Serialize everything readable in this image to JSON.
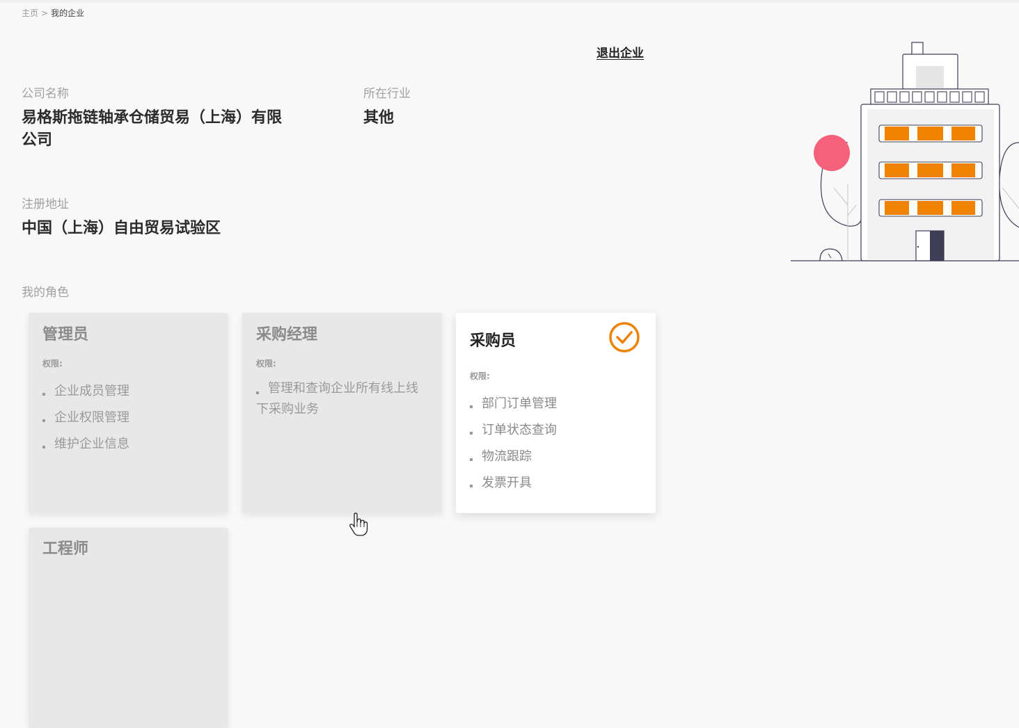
{
  "breadcrumb": {
    "home": "主页",
    "separator": ">",
    "current": "我的企业"
  },
  "actions": {
    "quit_label": "退出企业"
  },
  "company": {
    "name_label": "公司名称",
    "name_line1": "易格斯拖链轴承仓储贸易（上海）有限",
    "name_line2": "公司",
    "industry_label": "所在行业",
    "industry_value": "其他",
    "address_label": "注册地址",
    "address_value": "中国（上海）自由贸易试验区"
  },
  "roles": {
    "section_label": "我的角色",
    "items": [
      {
        "title": "管理员",
        "perm_label": "权限:",
        "perms": [
          "企业成员管理",
          "企业权限管理",
          "维护企业信息"
        ],
        "selected": false
      },
      {
        "title": "采购经理",
        "perm_label": "权限:",
        "perms": [
          "管理和查询企业所有线上线下采购业务"
        ],
        "selected": false
      },
      {
        "title": "采购员",
        "perm_label": "权限:",
        "perms": [
          "部门订单管理",
          "订单状态查询",
          "物流跟踪",
          "发票开具"
        ],
        "selected": true
      },
      {
        "title": "工程师",
        "selected": false
      }
    ]
  },
  "colors": {
    "accent": "#ef8200",
    "pink": "#f5617a",
    "door": "#3f3d56"
  },
  "icons": {
    "check": "check-circle-icon",
    "cursor": "hand-pointer-icon",
    "illustration": "office-building-illustration"
  }
}
